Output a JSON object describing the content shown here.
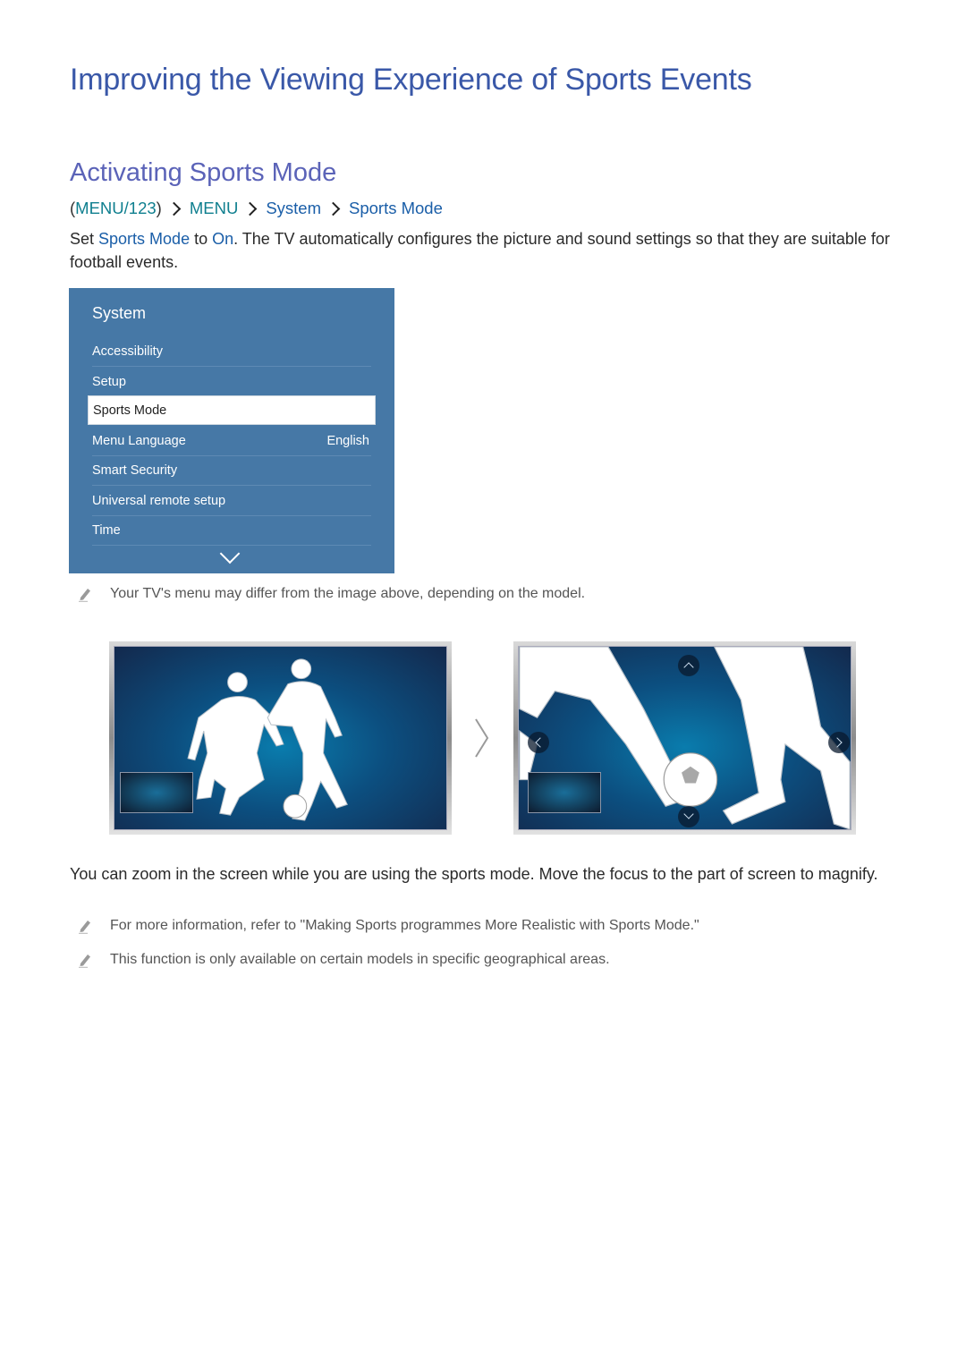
{
  "page": {
    "title": "Improving the Viewing Experience of Sports Events",
    "section_title": "Activating Sports Mode",
    "breadcrumb": {
      "open_paren": "(",
      "items": [
        "MENU/123",
        "MENU",
        "System",
        "Sports Mode"
      ],
      "close_paren": ")"
    },
    "intro": {
      "part1": "Set ",
      "link1": "Sports Mode",
      "part2": " to ",
      "link2": "On",
      "part3": ". The TV automatically configures the picture and sound settings so that they are suitable for football events."
    },
    "menu": {
      "title": "System",
      "items": [
        {
          "label": "Accessibility",
          "value": ""
        },
        {
          "label": "Setup",
          "value": ""
        },
        {
          "label": "Sports Mode",
          "value": "",
          "selected": true
        },
        {
          "label": "Menu Language",
          "value": "English"
        },
        {
          "label": "Smart Security",
          "value": ""
        },
        {
          "label": "Universal remote setup",
          "value": ""
        },
        {
          "label": "Time",
          "value": ""
        }
      ],
      "scroll_icon": "chevron-down-icon"
    },
    "notes": {
      "menu_note": "Your TV's menu may differ from the image above, depending on the model.",
      "more_info": "For more information, refer to \"Making Sports programmes More Realistic with Sports Mode.\"",
      "availability": "This function is only available on certain models in specific geographical areas."
    },
    "zoom_paragraph": "You can zoom in the screen while you are using the sports mode. Move the focus to the part of screen to magnify.",
    "illustrations": {
      "before": "tv-normal-view-football-players",
      "transition_icon": "chevron-right-icon",
      "after": "tv-zoomed-view-football-players",
      "nav_icons": [
        "chevron-up-icon",
        "chevron-down-icon",
        "chevron-left-icon",
        "chevron-right-icon"
      ]
    },
    "colors": {
      "title": "#3a58a8",
      "section": "#5b63b8",
      "link_blue": "#1a5ea8",
      "link_teal": "#0f7f8f",
      "menu_bg": "#4678a6"
    }
  }
}
